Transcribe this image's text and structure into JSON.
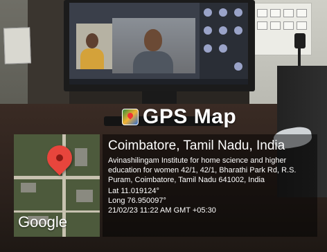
{
  "overlay": {
    "title": "GPS Map",
    "app_icon": "gps-map-camera-icon",
    "location": {
      "city": "Coimbatore, Tamil Nadu, India",
      "address": "Avinashilingam Institute for home science and higher education for women 42/1, 42/1, Bharathi Park Rd, R.S. Puram, Coimbatore, Tamil Nadu 641002, India",
      "latitude": "Lat 11.019124°",
      "longitude": "Long 76.950097°",
      "datetime": "21/02/23 11:22 AM GMT +05:30"
    },
    "map": {
      "logo": "Google",
      "pin_icon": "location-pin-icon",
      "pin_color": "#e8453c"
    }
  }
}
